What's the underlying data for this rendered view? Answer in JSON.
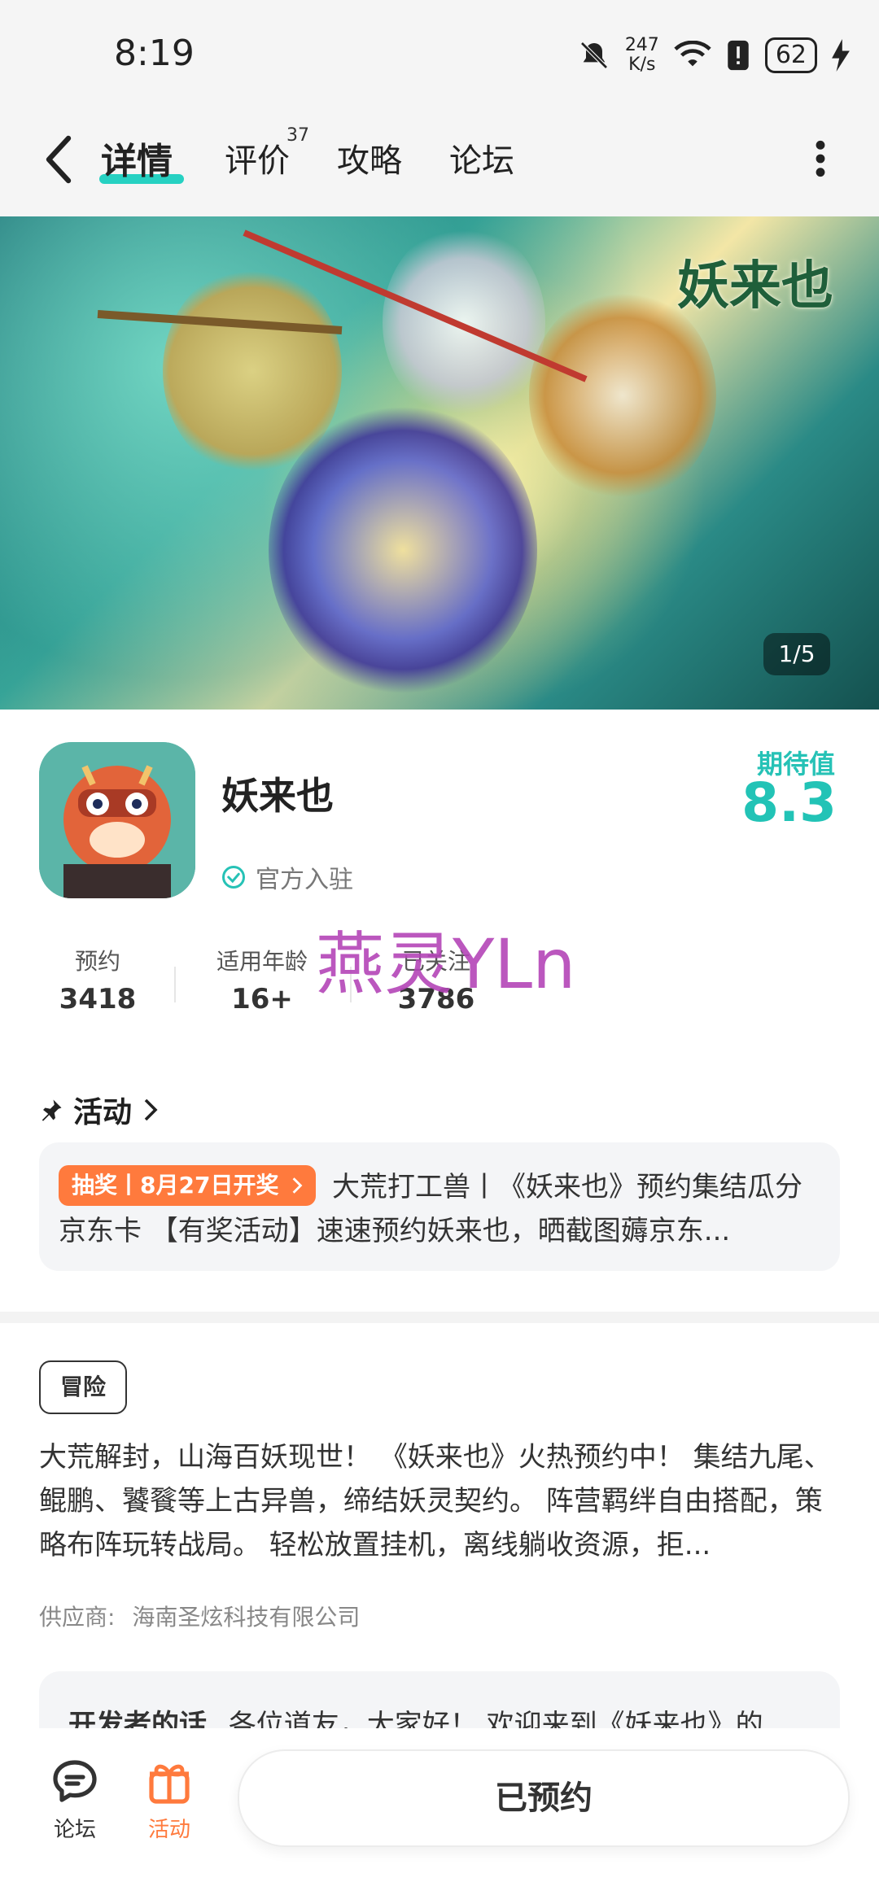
{
  "status": {
    "time": "8:19",
    "net_speed_value": "247",
    "net_speed_unit": "K/s",
    "battery": "62"
  },
  "nav": {
    "tabs": [
      {
        "label": "详情",
        "active": true
      },
      {
        "label": "评价",
        "badge": "37"
      },
      {
        "label": "攻略"
      },
      {
        "label": "论坛"
      }
    ]
  },
  "banner": {
    "title_art": "妖来也",
    "counter": "1/5"
  },
  "app": {
    "name": "妖来也",
    "official_label": "官方入驻",
    "expectation_label": "期待值",
    "expectation_value": "8.3"
  },
  "stats": [
    {
      "label": "预约",
      "value": "3418"
    },
    {
      "label": "适用年龄",
      "value": "16+"
    },
    {
      "label": "已关注",
      "value": "3786"
    }
  ],
  "watermark": "燕灵YLn",
  "activity": {
    "heading": "活动",
    "badge": "抽奖丨8月27日开奖",
    "text": "大荒打工兽丨《妖来也》预约集结瓜分京东卡 【有奖活动】速速预约妖来也，晒截图薅京东..."
  },
  "detail": {
    "tag": "冒险",
    "description": "大荒解封，山海百妖现世！ 《妖来也》火热预约中！ 集结九尾、鲲鹏、饕餮等上古异兽，缔结妖灵契约。 阵营羁绊自由搭配，策略布阵玩转战局。 轻松放置挂机，离线躺收资源，拒...",
    "supplier_label": "供应商:",
    "supplier_name": "海南圣炫科技有限公司",
    "dev_title": "开发者的话",
    "dev_text": "各位道友，大家好！ 欢迎来到《妖来也》的"
  },
  "bottom": {
    "forum_label": "论坛",
    "activity_label": "活动",
    "reserve_button": "已预约"
  },
  "colors": {
    "accent": "#26d1c2",
    "orange": "#ff7a3d",
    "watermark": "#b445b8"
  }
}
